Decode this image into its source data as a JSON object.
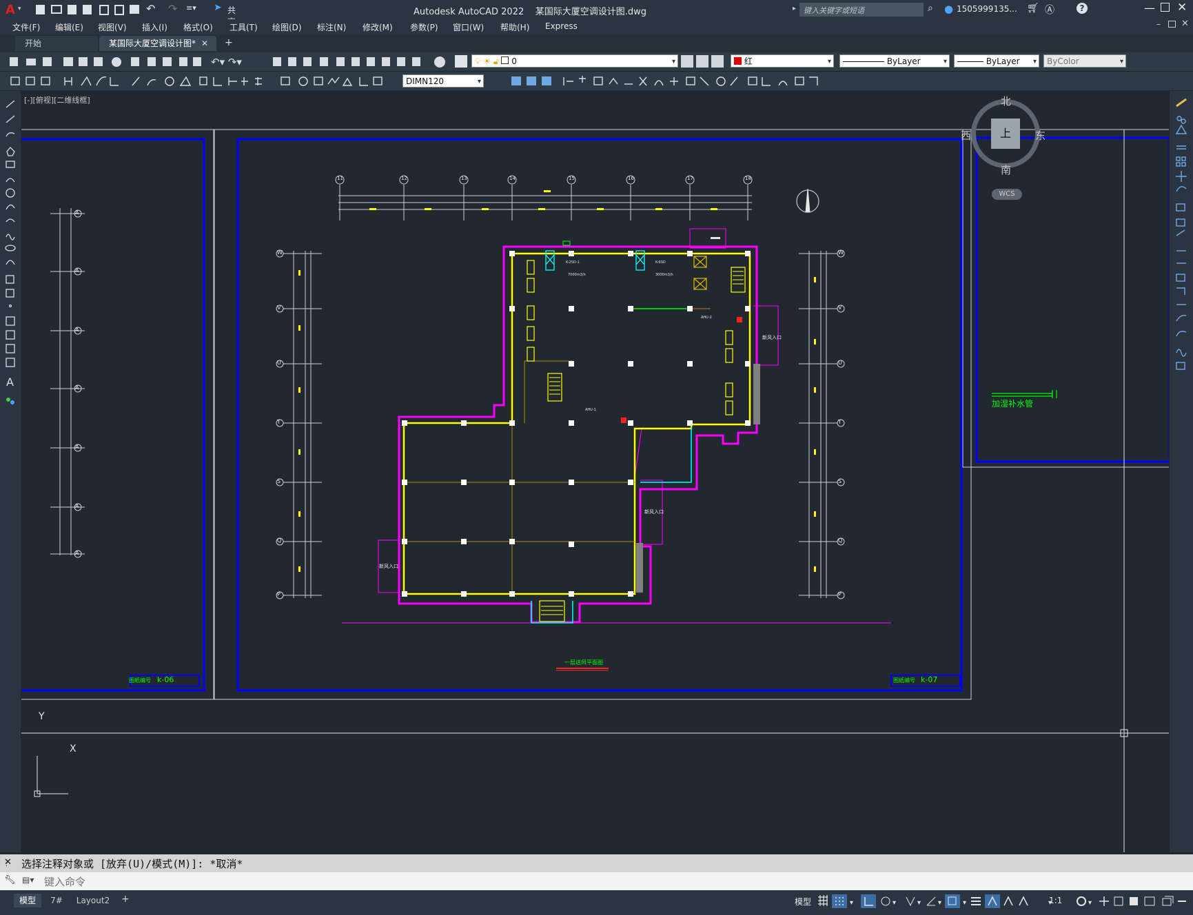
{
  "app": {
    "logo_letter": "A",
    "title": "Autodesk AutoCAD 2022    某国际大厦空调设计图.dwg",
    "share_label": "共享",
    "search_placeholder": "键入关键字或短语",
    "user_name": "1505999135...",
    "help_glyph": "?"
  },
  "menus": [
    "文件(F)",
    "编辑(E)",
    "视图(V)",
    "插入(I)",
    "格式(O)",
    "工具(T)",
    "绘图(D)",
    "标注(N)",
    "修改(M)",
    "参数(P)",
    "窗口(W)",
    "帮助(H)",
    "Express"
  ],
  "tabs": {
    "start": "开始",
    "active": "某国际大厦空调设计图*",
    "new": "+"
  },
  "layer": {
    "current": "0",
    "color_name": "红",
    "color_hex": "#e00000",
    "linetype": "ByLayer",
    "lineweight": "ByLayer",
    "plotstyle": "ByColor",
    "dimstyle": "DIMN120"
  },
  "viewport_label": "[-][俯视][二维线框]",
  "viewcube": {
    "north": "北",
    "south": "南",
    "east": "东",
    "west": "西",
    "face": "上",
    "wcs": "WCS"
  },
  "drawing": {
    "sheet_left_label": "图纸编号",
    "sheet_left_no": "k-06",
    "sheet_main_label": "图纸编号",
    "sheet_main_no": "k-07",
    "plan_title": "一层送风平面图",
    "right_annotation": "加湿补水管",
    "grid_top": [
      "11",
      "12",
      "13",
      "14",
      "15",
      "16",
      "17",
      "18"
    ],
    "grid_left": [
      "W",
      "V",
      "U",
      "T",
      "S",
      "Q",
      "P"
    ],
    "grid_far_left": [
      "A",
      "A",
      "A",
      "A",
      "A",
      "A",
      "A"
    ],
    "room_labels": {
      "entrance1": "新风入口",
      "entrance2": "新风入口",
      "entrance3": "新风入口"
    }
  },
  "ucs": {
    "x": "X",
    "y": "Y"
  },
  "command": {
    "history": "选择注释对象或 [放弃(U)/模式(M)]: *取消*",
    "input_placeholder": "键入命令"
  },
  "status": {
    "layout_tabs": [
      "模型",
      "7#",
      "Layout2"
    ],
    "add_layout": "+",
    "model_label": "模型",
    "scale": "1:1"
  },
  "colors": {
    "magenta": "#ff00ff",
    "yellow": "#ffff00",
    "blue": "#0000ff",
    "green": "#00ff00",
    "cyan": "#00ffff",
    "background": "#212830"
  }
}
